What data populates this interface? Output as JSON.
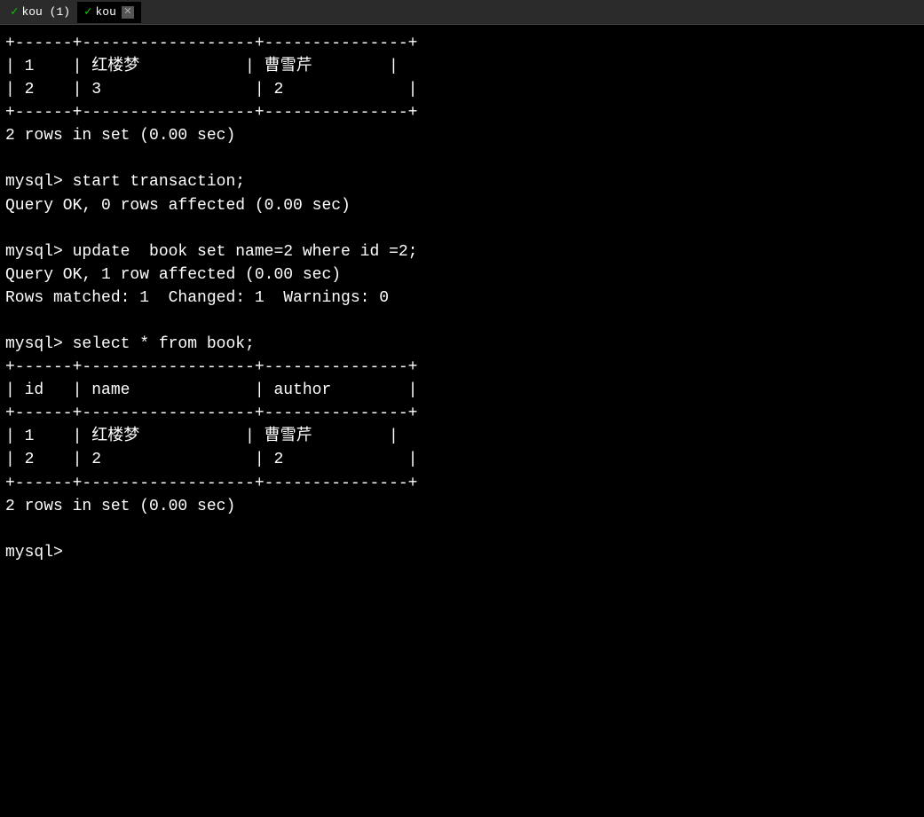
{
  "tabs": [
    {
      "id": "kou1",
      "label": "kou (1)",
      "active": false,
      "closable": false
    },
    {
      "id": "kou2",
      "label": "kou",
      "active": true,
      "closable": true
    }
  ],
  "terminal": {
    "lines": [
      "+------+------------------+---------------+",
      "| 1    | 红楼梦           | 曹雪芹        |",
      "| 2    | 3                | 2             |",
      "+------+------------------+---------------+",
      "2 rows in set (0.00 sec)",
      "",
      "mysql> start transaction;",
      "Query OK, 0 rows affected (0.00 sec)",
      "",
      "mysql> update  book set name=2 where id =2;",
      "Query OK, 1 row affected (0.00 sec)",
      "Rows matched: 1  Changed: 1  Warnings: 0",
      "",
      "mysql> select * from book;",
      "+------+------------------+---------------+",
      "| id   | name             | author        |",
      "+------+------------------+---------------+",
      "| 1    | 红楼梦           | 曹雪芹        |",
      "| 2    | 2                | 2             |",
      "+------+------------------+---------------+",
      "2 rows in set (0.00 sec)",
      "",
      "mysql> "
    ]
  }
}
